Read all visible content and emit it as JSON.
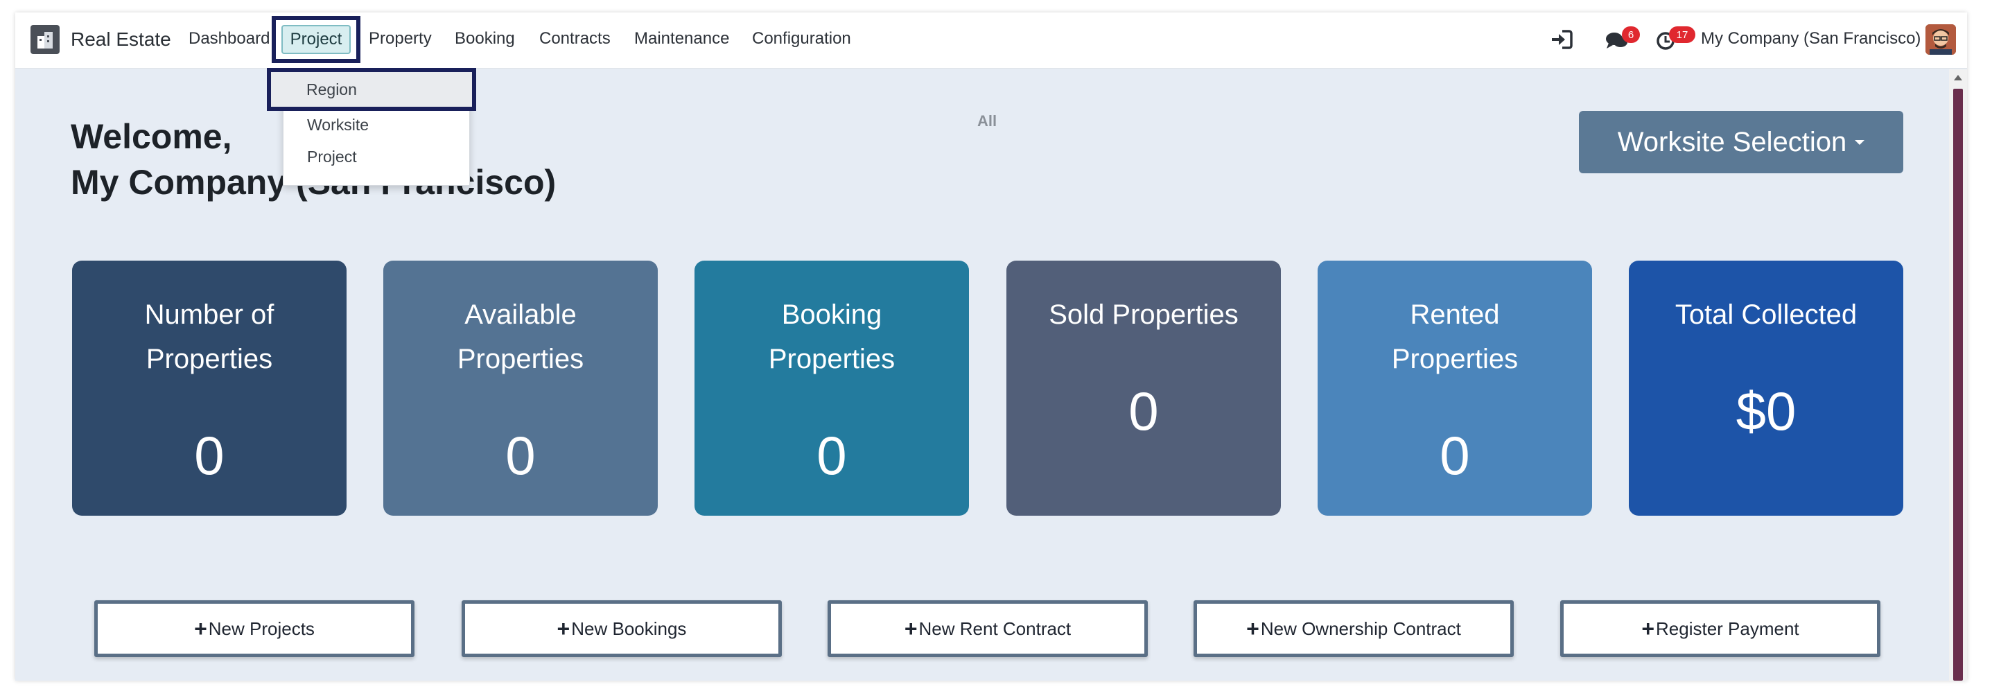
{
  "app": {
    "name": "Real Estate",
    "logo_icon": "building-icon"
  },
  "nav": {
    "items": [
      "Dashboard",
      "Project",
      "Property",
      "Booking",
      "Contracts",
      "Maintenance",
      "Configuration"
    ],
    "active": "Project"
  },
  "nav_right": {
    "login_icon": "login-icon",
    "messages_icon": "chat-icon",
    "messages_count": "6",
    "activities_icon": "clock-icon",
    "activities_count": "17",
    "company": "My Company (San Francisco)"
  },
  "dropdown": {
    "items": [
      "Region",
      "Worksite",
      "Project"
    ],
    "highlighted": "Region"
  },
  "welcome": {
    "line1": "Welcome,",
    "line2": "My Company (San Francisco)"
  },
  "filter": {
    "label": "All"
  },
  "worksite_button": {
    "label": "Worksite Selection"
  },
  "stats": [
    {
      "title_line1": "Number of",
      "title_line2": "Properties",
      "value": "0",
      "color": "#2f4a6b"
    },
    {
      "title_line1": "Available",
      "title_line2": "Properties",
      "value": "0",
      "color": "#547393"
    },
    {
      "title_line1": "Booking",
      "title_line2": "Properties",
      "value": "0",
      "color": "#237b9e"
    },
    {
      "title_line1": "Sold Properties",
      "title_line2": "",
      "value": "0",
      "color": "#525f79"
    },
    {
      "title_line1": "Rented",
      "title_line2": "Properties",
      "value": "0",
      "color": "#4b85bb"
    },
    {
      "title_line1": "Total Collected",
      "title_line2": "",
      "value": "$0",
      "color": "#1d54a8"
    }
  ],
  "actions": [
    {
      "label": "New Projects"
    },
    {
      "label": "New Bookings"
    },
    {
      "label": "New Rent Contract"
    },
    {
      "label": "New Ownership Contract"
    },
    {
      "label": "Register Payment"
    }
  ]
}
